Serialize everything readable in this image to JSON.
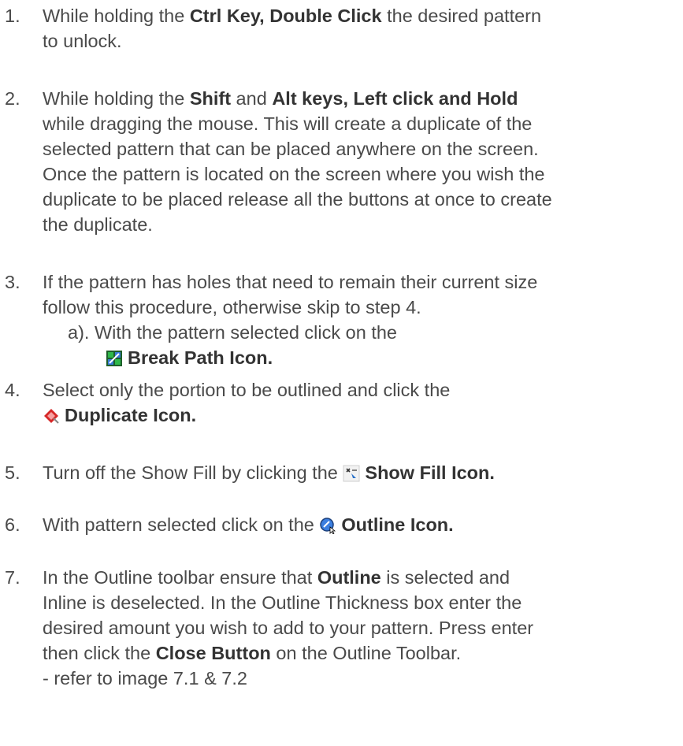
{
  "steps": [
    {
      "num": "1.",
      "l1a": "While holding the ",
      "l1b": "Ctrl Key, Double Click",
      "l1c": " the desired pattern",
      "l2": "to unlock."
    },
    {
      "num": "2.",
      "l1a": "While holding the ",
      "l1b": "Shift",
      "l1c": " and ",
      "l1d": "Alt keys, Left click and Hold",
      "l2": "while dragging the mouse. This will create a duplicate of the",
      "l3": "selected pattern that can be placed anywhere on the screen.",
      "l4": "Once the pattern is located on the screen where you wish the",
      "l5": "duplicate to be placed release all the buttons at once to create",
      "l6": "the duplicate."
    },
    {
      "num": "3.",
      "l1": "If the pattern has holes that need to remain their current size",
      "l2": "follow this procedure, otherwise skip to step 4.",
      "l3": "a). With the pattern selected click on the",
      "l4b": "Break Path Icon.",
      "icon": "break-path-icon"
    },
    {
      "num": "4.",
      "l1": "Select only the portion to be outlined and click the",
      "l2b": "Duplicate Icon.",
      "icon": "duplicate-icon"
    },
    {
      "num": "5.",
      "l1a": "Turn off the Show Fill by clicking the ",
      "l1b": "Show Fill Icon.",
      "icon": "show-fill-icon"
    },
    {
      "num": "6.",
      "l1a": "With pattern selected click on the ",
      "l1b": "Outline Icon.",
      "icon": "outline-icon"
    },
    {
      "num": "7.",
      "l1a": "In the Outline toolbar ensure that ",
      "l1b": "Outline",
      "l1c": " is selected and",
      "l2": "Inline is deselected. In the Outline Thickness box enter the",
      "l3": "desired amount you wish to add to your pattern. Press enter",
      "l4a": "then click the ",
      "l4b": "Close Button",
      "l4c": " on the Outline Toolbar.",
      "l5": "- refer to image 7.1 & 7.2"
    }
  ]
}
